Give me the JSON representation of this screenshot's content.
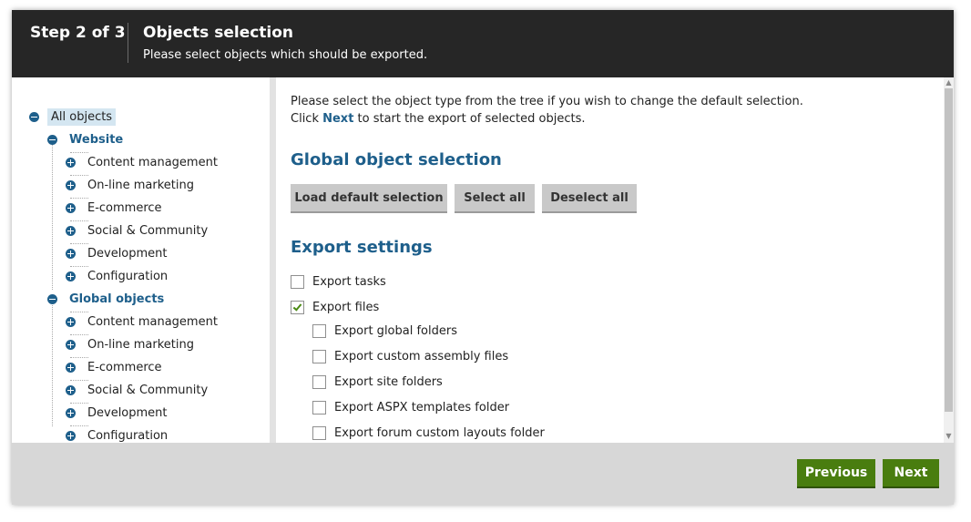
{
  "header": {
    "step": "Step 2 of 3",
    "title": "Objects selection",
    "subtitle": "Please select objects which should be exported."
  },
  "tree": {
    "root": "All objects",
    "website": {
      "label": "Website",
      "children": [
        "Content management",
        "On-line marketing",
        "E-commerce",
        "Social & Community",
        "Development",
        "Configuration"
      ]
    },
    "global": {
      "label": "Global objects",
      "children": [
        "Content management",
        "On-line marketing",
        "E-commerce",
        "Social & Community",
        "Development",
        "Configuration"
      ]
    }
  },
  "content": {
    "instruction_line1": "Please select the object type from the tree if you wish to change the default selection.",
    "instruction_line2_prefix": "Click ",
    "instruction_line2_bold": "Next",
    "instruction_line2_suffix": " to start the export of selected objects.",
    "global_selection_title": "Global object selection",
    "buttons": {
      "load_default": "Load default selection",
      "select_all": "Select all",
      "deselect_all": "Deselect all"
    },
    "export_settings_title": "Export settings",
    "checkboxes": [
      {
        "label": "Export tasks",
        "checked": false
      },
      {
        "label": "Export files",
        "checked": true
      },
      {
        "label": "Export global folders",
        "checked": false
      },
      {
        "label": "Export custom assembly files",
        "checked": false
      },
      {
        "label": "Export site folders",
        "checked": false
      },
      {
        "label": "Export ASPX templates folder",
        "checked": false
      },
      {
        "label": "Export forum custom layouts folder",
        "checked": false
      }
    ]
  },
  "footer": {
    "previous": "Previous",
    "next": "Next"
  },
  "colors": {
    "header_bg": "#262626",
    "accent_blue": "#1e5f8b",
    "primary_green": "#497d0f"
  }
}
